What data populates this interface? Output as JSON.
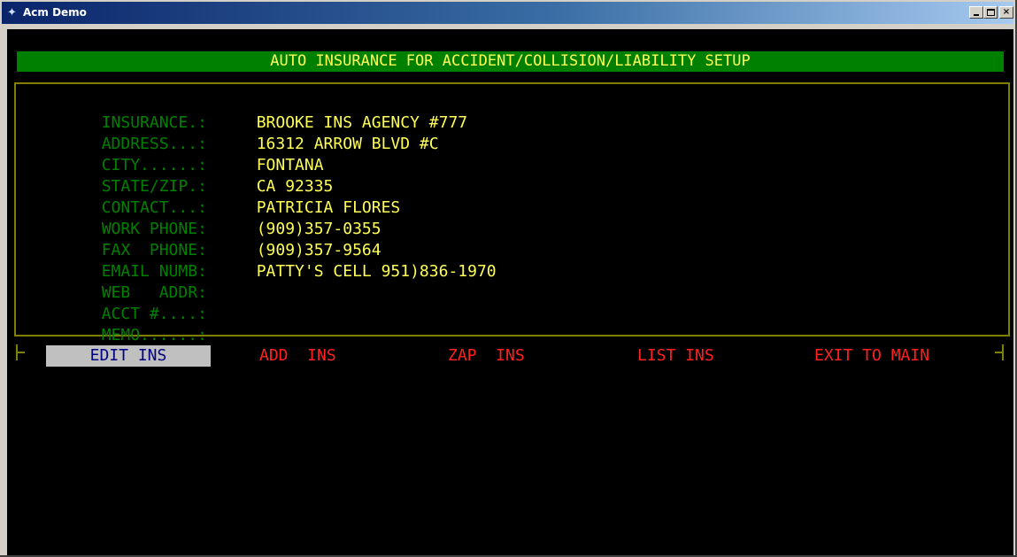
{
  "window": {
    "title": "Acm Demo",
    "icon": "app-icon",
    "controls": [
      "minimize",
      "maximize",
      "close"
    ],
    "close_glyph": "×"
  },
  "colors": {
    "background": "#000000",
    "header_bar": "#008000",
    "header_text": "#ffff55",
    "label_text": "#008000",
    "value_text": "#ffff55",
    "frame": "#808000",
    "menu_text": "#ff2020",
    "menu_selected_bg": "#c0c0c0",
    "menu_selected_text": "#000080"
  },
  "header": {
    "title": "AUTO INSURANCE FOR ACCIDENT/COLLISION/LIABILITY SETUP"
  },
  "fields": [
    {
      "label": "INSURANCE.:",
      "value": "BROOKE INS AGENCY #777"
    },
    {
      "label": "ADDRESS...:",
      "value": "16312 ARROW BLVD #C"
    },
    {
      "label": "CITY......:",
      "value": "FONTANA"
    },
    {
      "label": "STATE/ZIP.:",
      "value": "CA 92335"
    },
    {
      "label": "CONTACT...:",
      "value": "PATRICIA FLORES"
    },
    {
      "label": "WORK PHONE:",
      "value": "(909)357-0355"
    },
    {
      "label": "FAX  PHONE:",
      "value": "(909)357-9564"
    },
    {
      "label": "EMAIL NUMB:",
      "value": "PATTY'S CELL 951)836-1970"
    },
    {
      "label": "WEB   ADDR:",
      "value": ""
    },
    {
      "label": "ACCT #....:",
      "value": ""
    },
    {
      "label": "MEMO......:",
      "value": ""
    }
  ],
  "menu": {
    "selected": "EDIT INS",
    "items": [
      {
        "label": "EDIT INS"
      },
      {
        "label": "ADD  INS"
      },
      {
        "label": "ZAP  INS"
      },
      {
        "label": "LIST INS"
      },
      {
        "label": "EXIT TO MAIN"
      }
    ]
  }
}
